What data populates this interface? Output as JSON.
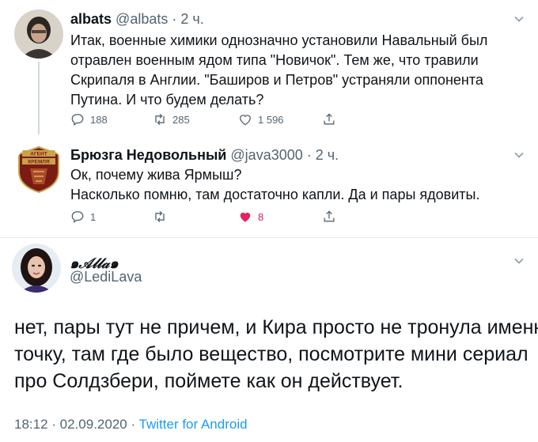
{
  "tweets": [
    {
      "name": "albats",
      "handle": "@albats",
      "sep": "·",
      "time": "2 ч.",
      "text_lines": [
        "Итак, военные химики однозначно установили Навальный был",
        "отравлен военным ядом типа \"Новичок\". Тем же, что травили",
        "Скрипаля в Англии. \"Баширов и Петров\" устраняли оппонента",
        "Путина. И что будем делать?"
      ],
      "replies": "188",
      "retweets": "285",
      "likes": "1 596"
    },
    {
      "name": "Брюзга Недовольный",
      "handle": "@java3000",
      "sep": "·",
      "time": "2 ч.",
      "avatar_text_top": "АГЕНТ",
      "avatar_text_bottom": "КРЕМЛЯ",
      "text_lines": [
        "Ок, почему жива Ярмыш?",
        "Насколько помню, там достаточно капли. Да и пары ядовиты."
      ],
      "replies": "1",
      "retweets": "",
      "likes": "8"
    }
  ],
  "main": {
    "name": "๑𝒜𝓁𝓁𝒶๑",
    "handle": "@LediLava",
    "text_lines": [
      "нет, пары тут не причем, и Кира просто не тронула именно",
      "точку, там где было вещество, посмотрите мини  сериал",
      "про Солдзбери, поймете как он действует."
    ],
    "time": "18:12 · 02.09.2020 ·",
    "source": "Twitter for Android"
  },
  "colors": {
    "secondary_text": "#536471",
    "link": "#1d9bf0",
    "like_active": "#e0245e",
    "thread_line": "#cfd9de"
  }
}
